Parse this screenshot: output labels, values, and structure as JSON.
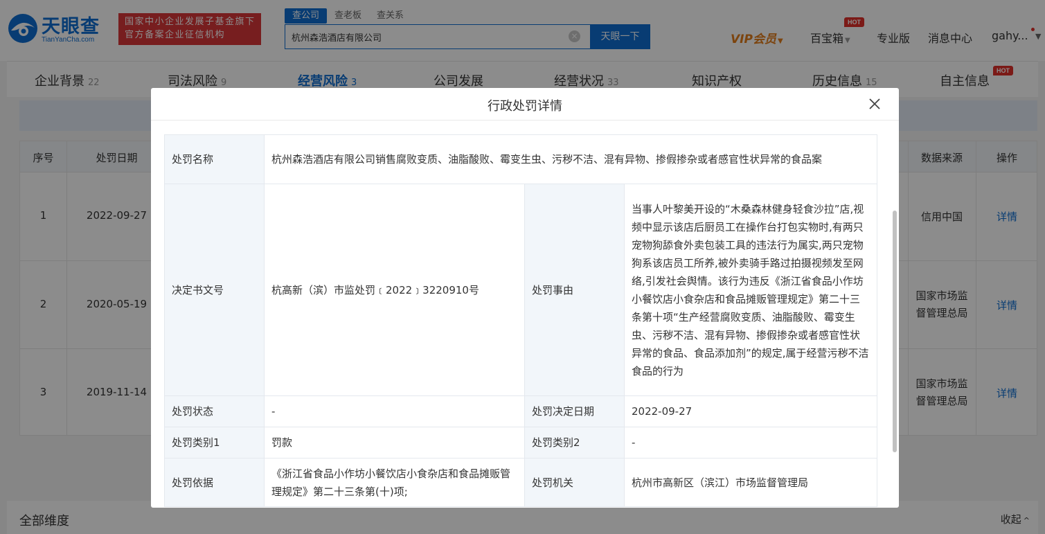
{
  "header": {
    "logo_cn": "天眼查",
    "logo_en": "TianYanCha.com",
    "gov_badge_line1": "国家中小企业发展子基金旗下",
    "gov_badge_line2": "官方备案企业征信机构",
    "search_tabs": [
      "查公司",
      "查老板",
      "查关系"
    ],
    "search_value": "杭州森浩酒店有限公司",
    "search_button": "天眼一下",
    "vip": "VIP会员",
    "baibaoxiang": "百宝箱",
    "hot": "HOT",
    "pro": "专业版",
    "messages": "消息中心",
    "user": "gahy..."
  },
  "tabs": [
    {
      "label": "企业背景",
      "count": "22"
    },
    {
      "label": "司法风险",
      "count": "9"
    },
    {
      "label": "经营风险",
      "count": "3"
    },
    {
      "label": "公司发展",
      "count": ""
    },
    {
      "label": "经营状况",
      "count": "33"
    },
    {
      "label": "知识产权",
      "count": ""
    },
    {
      "label": "历史信息",
      "count": "15"
    },
    {
      "label": "自主信息",
      "count": ""
    }
  ],
  "bg_table": {
    "headers": {
      "index": "序号",
      "date": "处罚日期",
      "source": "数据来源",
      "action": "操作"
    },
    "rows": [
      {
        "index": "1",
        "date": "2022-09-27",
        "source_line1": "信用中国",
        "source_line2": "",
        "action": "详情"
      },
      {
        "index": "2",
        "date": "2020-05-19",
        "source_line1": "国家市场监",
        "source_line2": "督管理总局",
        "action": "详情"
      },
      {
        "index": "3",
        "date": "2019-11-14",
        "source_line1": "国家市场监",
        "source_line2": "督管理总局",
        "action": "详情"
      }
    ]
  },
  "bottom": {
    "all_dims": "全部维度",
    "collapse": "收起"
  },
  "modal": {
    "title": "行政处罚详情",
    "labels": {
      "name": "处罚名称",
      "doc_no": "决定书文号",
      "reason": "处罚事由",
      "status": "处罚状态",
      "decision_date": "处罚决定日期",
      "category1": "处罚类别1",
      "category2": "处罚类别2",
      "basis": "处罚依据",
      "authority": "处罚机关"
    },
    "values": {
      "name": "杭州森浩酒店有限公司销售腐败变质、油脂酸败、霉变生虫、污秽不洁、混有异物、掺假掺杂或者感官性状异常的食品案",
      "doc_no": "杭高新（滨）市监处罚﹝2022﹞3220910号",
      "reason": "当事人叶黎美开设的“木桑森林健身轻食沙拉”店,视频中显示该店后厨员工在操作台打包实物时,有两只宠物狗舔食外卖包装工具的违法行为属实,两只宠物狗系该店员工所养,被外卖骑手路过拍摄视频发至网络,引发社会舆情。该行为违反《浙江省食品小作坊小餐饮店小食杂店和食品摊贩管理规定》第二十三条第十项“生产经营腐败变质、油脂酸败、霉变生虫、污秽不洁、混有异物、掺假掺杂或者感官性状异常的食品、食品添加剂”的规定,属于经营污秽不洁食品的行为",
      "status": "-",
      "decision_date": "2022-09-27",
      "category1": "罚款",
      "category2": "-",
      "basis": "《浙江省食品小作坊小餐饮店小食杂店和食品摊贩管理规定》第二十三条第(十)项;",
      "authority": "杭州市高新区（滨江）市场监督管理局"
    }
  }
}
